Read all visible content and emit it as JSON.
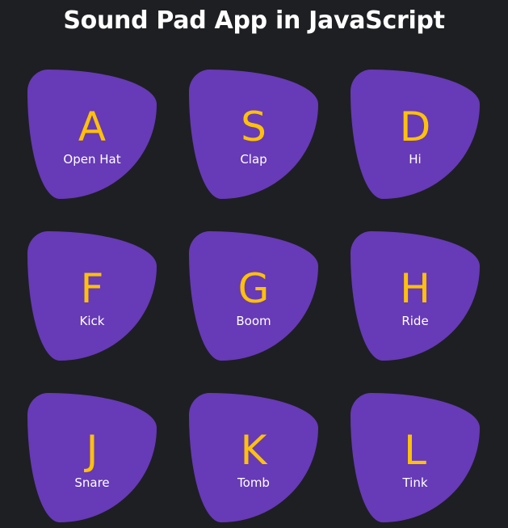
{
  "header": {
    "title": "Sound Pad App in JavaScript"
  },
  "pads": [
    {
      "key": "A",
      "sound": "Open Hat"
    },
    {
      "key": "S",
      "sound": "Clap"
    },
    {
      "key": "D",
      "sound": "Hi"
    },
    {
      "key": "F",
      "sound": "Kick"
    },
    {
      "key": "G",
      "sound": "Boom"
    },
    {
      "key": "H",
      "sound": "Ride"
    },
    {
      "key": "J",
      "sound": "Snare"
    },
    {
      "key": "K",
      "sound": "Tomb"
    },
    {
      "key": "L",
      "sound": "Tink"
    }
  ],
  "colors": {
    "background": "#1e1f22",
    "pad": "#673ab7",
    "key_letter": "#ffc107",
    "sound_label": "#ffffff"
  }
}
